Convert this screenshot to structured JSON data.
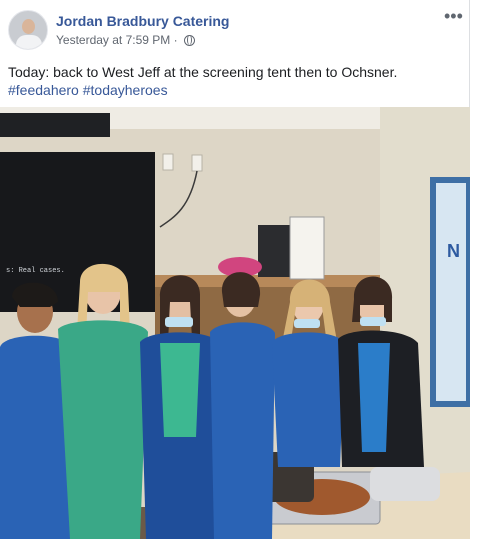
{
  "post": {
    "author": "Jordan Bradbury Catering",
    "timestamp": "Yesterday at 7:59 PM",
    "privacy_icon": "globe-icon",
    "more_icon": "more-options-icon",
    "text": "Today: back to West Jeff at the screening tent then to Ochsner.",
    "hashtags": [
      "#feedahero",
      "#todayheroes"
    ]
  },
  "photo": {
    "tv_screen_text": "s: Real cases.",
    "bulletin_letters": "N"
  },
  "colors": {
    "link": "#385898",
    "meta": "#616770",
    "text": "#1c1e21"
  }
}
